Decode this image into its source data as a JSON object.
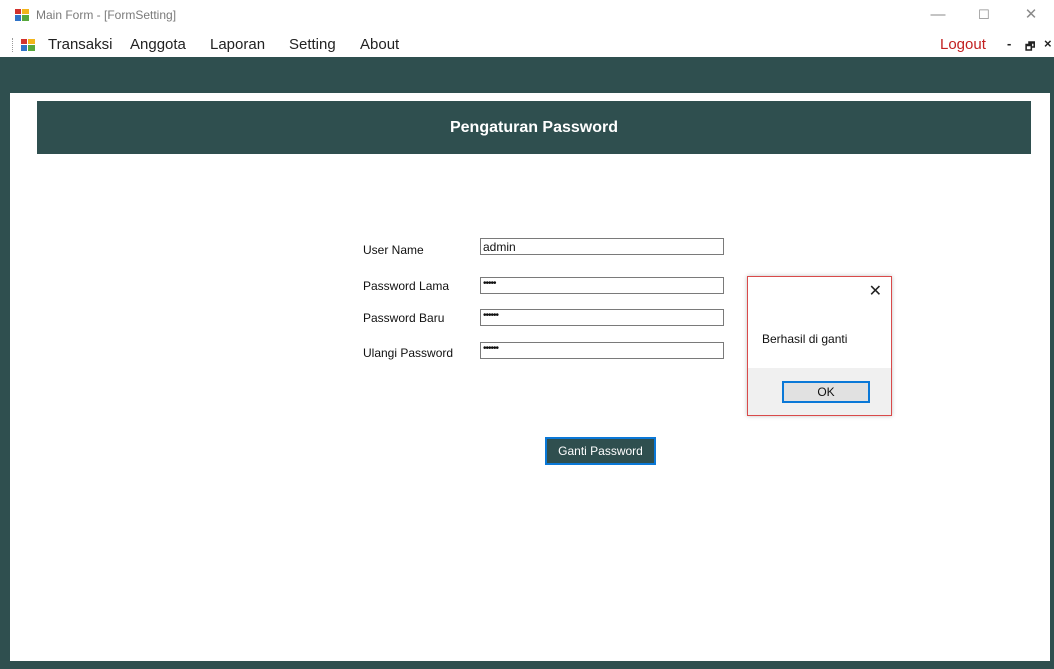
{
  "titlebar": {
    "icon": "app-form-icon",
    "title": "Main Form - [FormSetting]",
    "minimize": "—",
    "maximize": "☐",
    "close": "✕"
  },
  "menubar": {
    "items": [
      {
        "label": "Transaksi"
      },
      {
        "label": "Anggota"
      },
      {
        "label": "Laporan"
      },
      {
        "label": "Setting"
      },
      {
        "label": "About"
      }
    ],
    "logout": "Logout",
    "mdi_minimize": "-",
    "mdi_restore": "🗗",
    "mdi_close": "×"
  },
  "form": {
    "header_title": "Pengaturan Password",
    "fields": {
      "username": {
        "label": "User Name",
        "value": "admin"
      },
      "old_password": {
        "label": "Password Lama",
        "value": "•••••"
      },
      "new_password": {
        "label": "Password Baru",
        "value": "••••••"
      },
      "confirm_password": {
        "label": "Ulangi Password",
        "value": "••••••"
      }
    },
    "submit_label": "Ganti Password"
  },
  "messagebox": {
    "message": "Berhasil di ganti",
    "ok_label": "OK",
    "close": "✕"
  },
  "colors": {
    "accent": "#2f4f4f",
    "focus": "#0a78d7",
    "logout": "#c21f1f"
  }
}
